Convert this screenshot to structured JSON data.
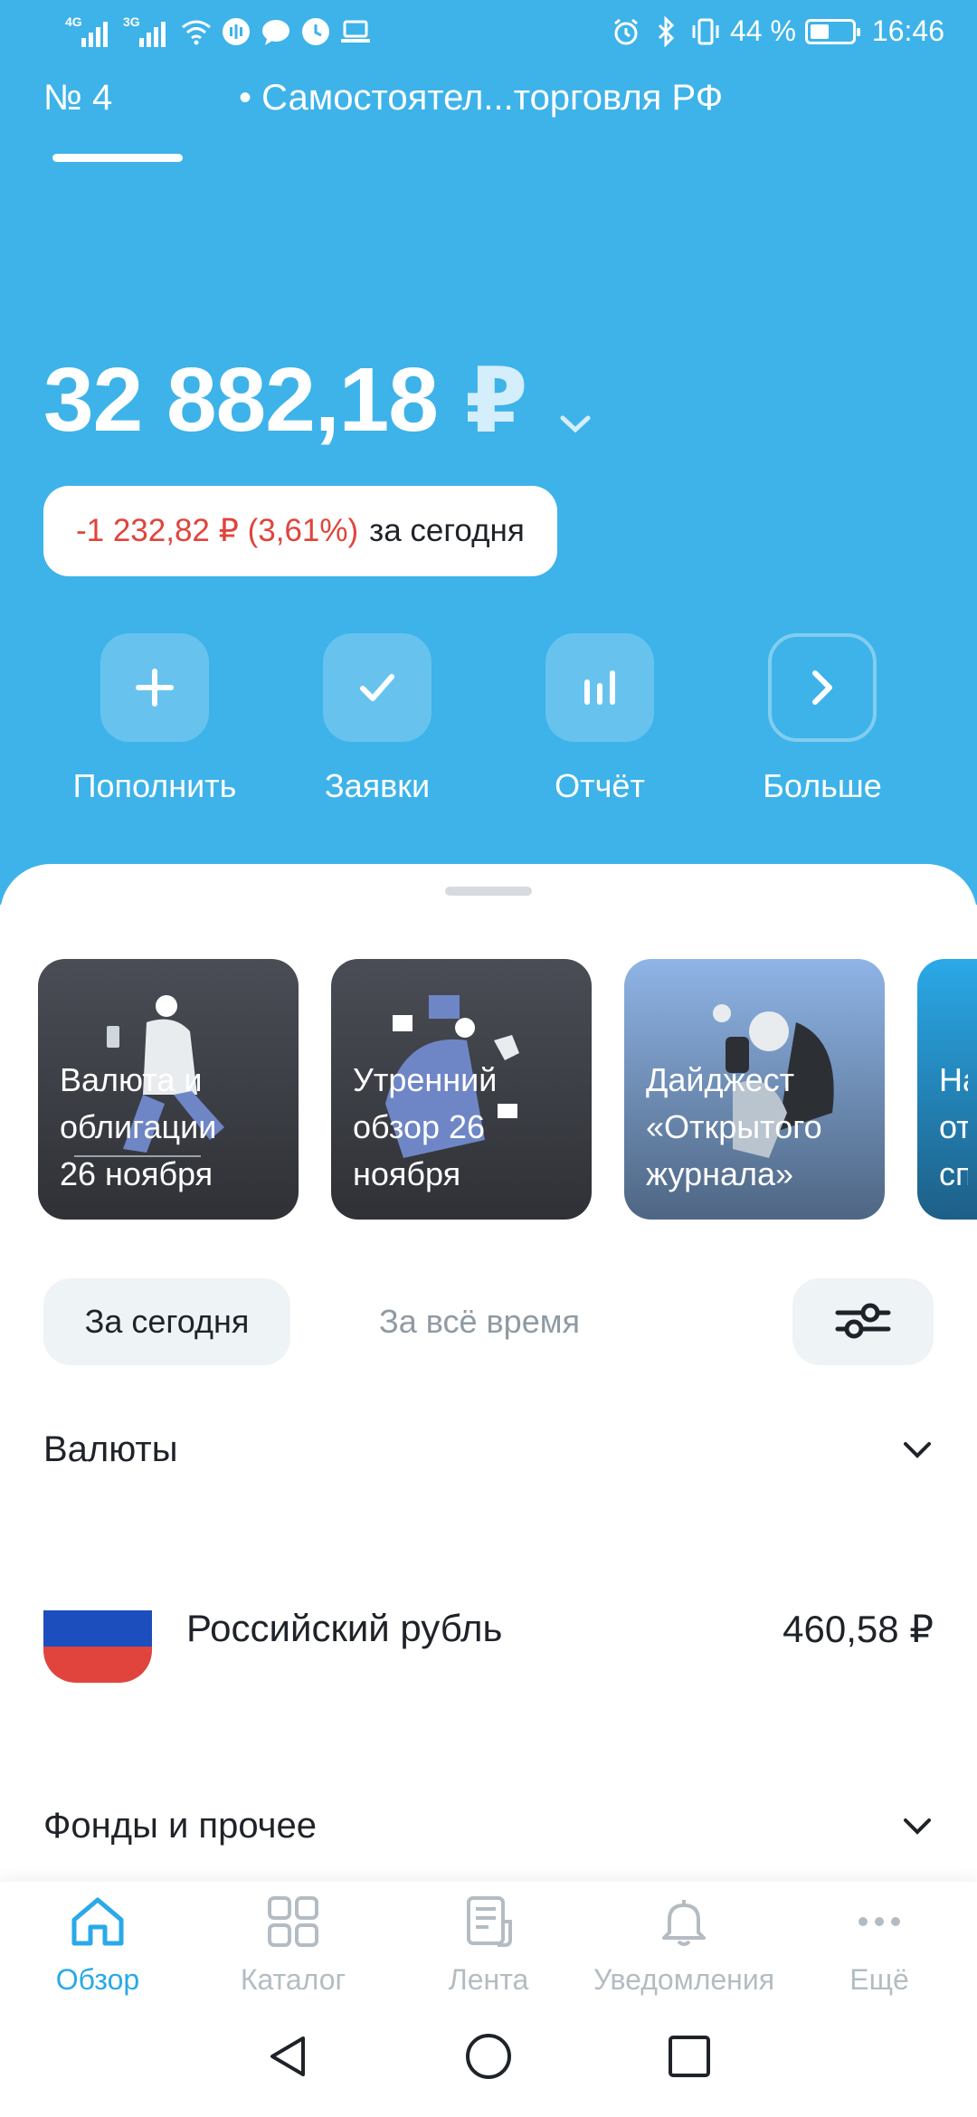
{
  "status_bar": {
    "signal1_label": "4G",
    "signal2_label": "3G",
    "battery_percent": "44 %",
    "time": "16:46"
  },
  "account_tabs": [
    {
      "label": "№ 4",
      "active": true
    },
    {
      "label": "• Самостоятел...торговля РФ",
      "active": false
    }
  ],
  "balance": {
    "amount": "32 882,18",
    "currency": "₽"
  },
  "day_change": {
    "value": "-1 232,82 ₽ (3,61%)",
    "label": "за сегодня"
  },
  "actions": [
    {
      "label": "Пополнить",
      "icon": "plus-icon"
    },
    {
      "label": "Заявки",
      "icon": "check-icon"
    },
    {
      "label": "Отчёт",
      "icon": "bar-chart-icon"
    },
    {
      "label": "Больше",
      "icon": "chevron-right-icon"
    }
  ],
  "stories": [
    {
      "line1": "Валюта и",
      "line2": "облигации",
      "line3": "26 ноября"
    },
    {
      "line1": "Утренний",
      "line2": "обзор 26",
      "line3": "ноября"
    },
    {
      "line1": "Дайджест",
      "line2": "«Открытого",
      "line3": "журнала»"
    },
    {
      "line1": "На",
      "line2": "от",
      "line3": "сп"
    }
  ],
  "period_filter": {
    "today": "За сегодня",
    "all_time": "За всё время"
  },
  "sections": {
    "currencies": "Валюты",
    "funds": "Фонды и прочее"
  },
  "assets": [
    {
      "name": "Российский рубль",
      "amount": "460,58 ₽"
    }
  ],
  "bottom_nav": [
    {
      "label": "Обзор",
      "icon": "home-icon",
      "active": true
    },
    {
      "label": "Каталог",
      "icon": "grid-icon",
      "active": false
    },
    {
      "label": "Лента",
      "icon": "feed-icon",
      "active": false
    },
    {
      "label": "Уведомления",
      "icon": "bell-icon",
      "active": false
    },
    {
      "label": "Ещё",
      "icon": "more-dots-icon",
      "active": false
    }
  ],
  "colors": {
    "header_bg": "#3db3e9",
    "negative": "#e0443c",
    "accent": "#2aa9e8"
  }
}
